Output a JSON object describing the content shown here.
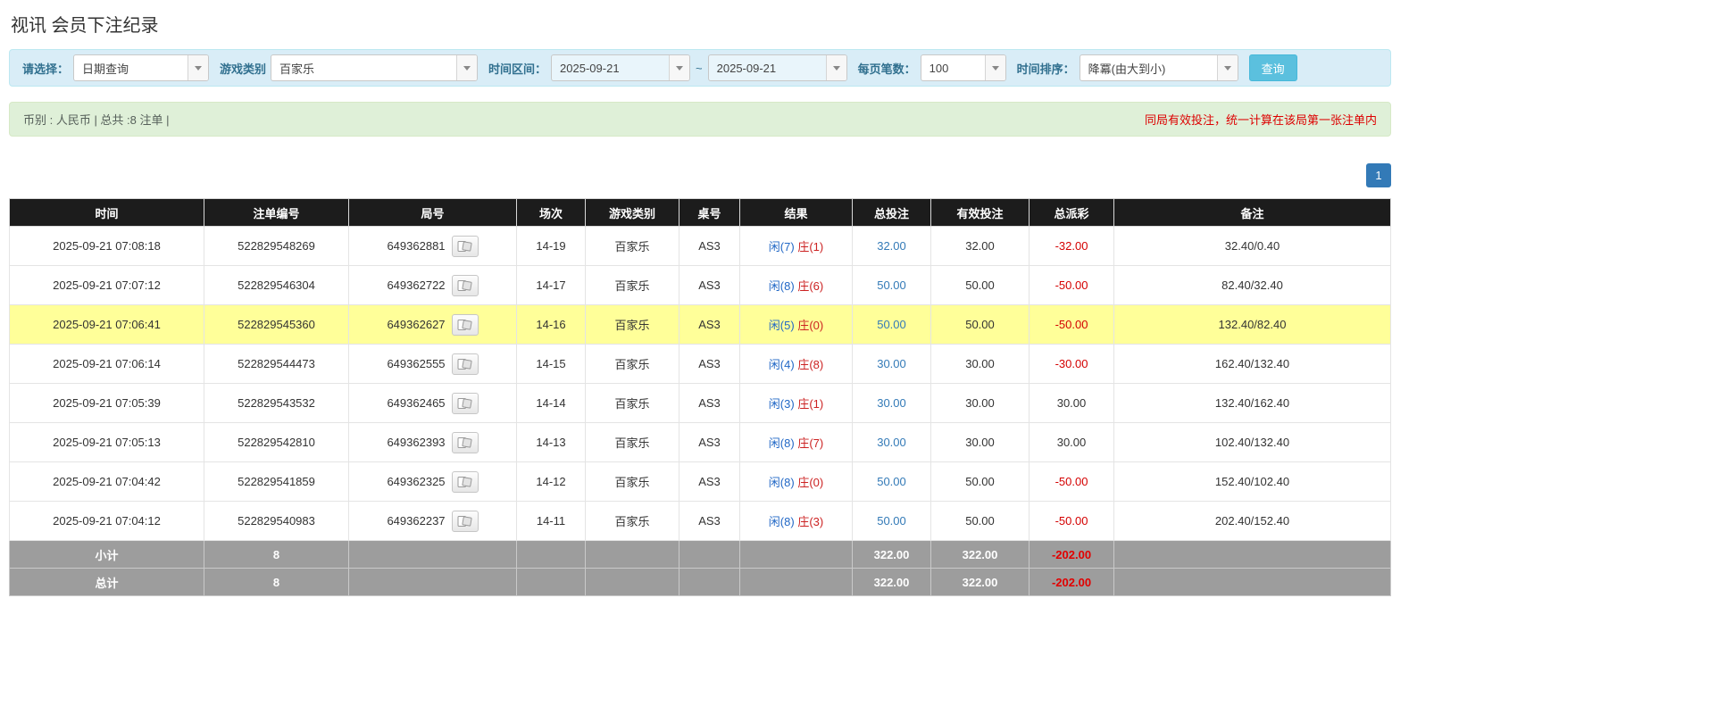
{
  "colors": {
    "accent": "#5bc0de",
    "link_blue": "#337ab7",
    "negative_red": "#d40000",
    "notice_red": "#dd0000",
    "highlight_yellow": "#ffff99",
    "header_bg": "#1c1c1c",
    "footer_bg": "#9d9d9d",
    "filter_bg": "#d9edf7",
    "summary_bg": "#dff0d8"
  },
  "page": {
    "title": "视讯 会员下注纪录"
  },
  "filters": {
    "query_type_label": "请选择：",
    "query_type_value": "日期查询",
    "game_type_label": "游戏类别",
    "game_type_value": "百家乐",
    "time_range_label": "时间区间：",
    "date_from": "2025-09-21",
    "range_separator": "~",
    "date_to": "2025-09-21",
    "page_size_label": "每页笔数：",
    "page_size_value": "100",
    "sort_label": "时间排序：",
    "sort_value": "降冪(由大到小)",
    "search_button_label": "查询"
  },
  "summary": {
    "currency_info": "币别 : 人民币 | 总共 :8 注单 |",
    "notice": "同局有效投注，统一计算在该局第一张注单内"
  },
  "pagination": {
    "page": "1"
  },
  "table": {
    "headers": [
      "时间",
      "注单编号",
      "局号",
      "场次",
      "游戏类别",
      "桌号",
      "结果",
      "总投注",
      "有效投注",
      "总派彩",
      "备注"
    ],
    "rows": [
      {
        "time": "2025-09-21 07:08:18",
        "bet_id": "522829548269",
        "round": "649362881",
        "session": "14-19",
        "game": "百家乐",
        "table_no": "AS3",
        "result_player": "闲(7)",
        "result_banker": "庄(1)",
        "total_bet": "32.00",
        "valid_bet": "32.00",
        "payout": "-32.00",
        "note": "32.40/0.40",
        "highlight": false
      },
      {
        "time": "2025-09-21 07:07:12",
        "bet_id": "522829546304",
        "round": "649362722",
        "session": "14-17",
        "game": "百家乐",
        "table_no": "AS3",
        "result_player": "闲(8)",
        "result_banker": "庄(6)",
        "total_bet": "50.00",
        "valid_bet": "50.00",
        "payout": "-50.00",
        "note": "82.40/32.40",
        "highlight": false
      },
      {
        "time": "2025-09-21 07:06:41",
        "bet_id": "522829545360",
        "round": "649362627",
        "session": "14-16",
        "game": "百家乐",
        "table_no": "AS3",
        "result_player": "闲(5)",
        "result_banker": "庄(0)",
        "total_bet": "50.00",
        "valid_bet": "50.00",
        "payout": "-50.00",
        "note": "132.40/82.40",
        "highlight": true
      },
      {
        "time": "2025-09-21 07:06:14",
        "bet_id": "522829544473",
        "round": "649362555",
        "session": "14-15",
        "game": "百家乐",
        "table_no": "AS3",
        "result_player": "闲(4)",
        "result_banker": "庄(8)",
        "total_bet": "30.00",
        "valid_bet": "30.00",
        "payout": "-30.00",
        "note": "162.40/132.40",
        "highlight": false
      },
      {
        "time": "2025-09-21 07:05:39",
        "bet_id": "522829543532",
        "round": "649362465",
        "session": "14-14",
        "game": "百家乐",
        "table_no": "AS3",
        "result_player": "闲(3)",
        "result_banker": "庄(1)",
        "total_bet": "30.00",
        "valid_bet": "30.00",
        "payout": "30.00",
        "note": "132.40/162.40",
        "highlight": false
      },
      {
        "time": "2025-09-21 07:05:13",
        "bet_id": "522829542810",
        "round": "649362393",
        "session": "14-13",
        "game": "百家乐",
        "table_no": "AS3",
        "result_player": "闲(8)",
        "result_banker": "庄(7)",
        "total_bet": "30.00",
        "valid_bet": "30.00",
        "payout": "30.00",
        "note": "102.40/132.40",
        "highlight": false
      },
      {
        "time": "2025-09-21 07:04:42",
        "bet_id": "522829541859",
        "round": "649362325",
        "session": "14-12",
        "game": "百家乐",
        "table_no": "AS3",
        "result_player": "闲(8)",
        "result_banker": "庄(0)",
        "total_bet": "50.00",
        "valid_bet": "50.00",
        "payout": "-50.00",
        "note": "152.40/102.40",
        "highlight": false
      },
      {
        "time": "2025-09-21 07:04:12",
        "bet_id": "522829540983",
        "round": "649362237",
        "session": "14-11",
        "game": "百家乐",
        "table_no": "AS3",
        "result_player": "闲(8)",
        "result_banker": "庄(3)",
        "total_bet": "50.00",
        "valid_bet": "50.00",
        "payout": "-50.00",
        "note": "202.40/152.40",
        "highlight": false
      }
    ],
    "subtotal": {
      "label": "小计",
      "count": "8",
      "total_bet": "322.00",
      "valid_bet": "322.00",
      "payout": "-202.00"
    },
    "grand_total": {
      "label": "总计",
      "count": "8",
      "total_bet": "322.00",
      "valid_bet": "322.00",
      "payout": "-202.00"
    }
  }
}
